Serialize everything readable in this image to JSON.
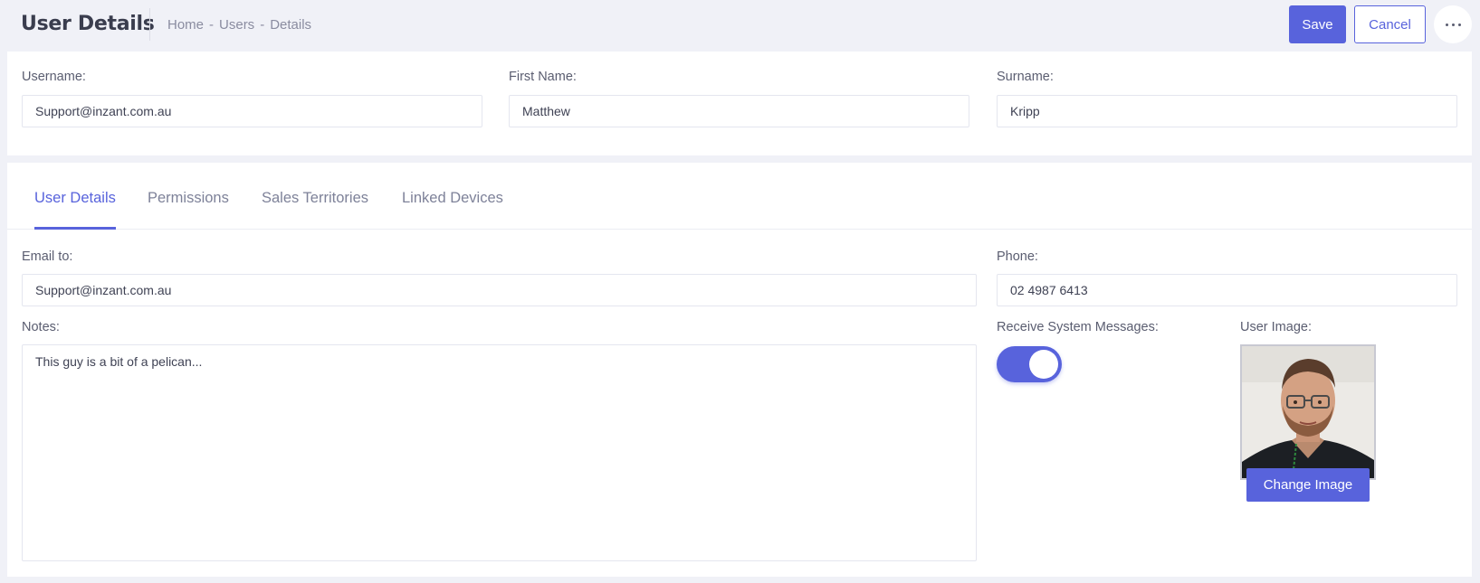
{
  "header": {
    "title": "User Details",
    "breadcrumb": [
      "Home",
      "Users",
      "Details"
    ],
    "breadcrumb_sep": "-",
    "save_label": "Save",
    "cancel_label": "Cancel",
    "more_icon": "more-horizontal-icon"
  },
  "top_form": {
    "username_label": "Username:",
    "username_value": "Support@inzant.com.au",
    "firstname_label": "First Name:",
    "firstname_value": "Matthew",
    "surname_label": "Surname:",
    "surname_value": "Kripp"
  },
  "tabs": [
    {
      "label": "User Details",
      "active": true
    },
    {
      "label": "Permissions",
      "active": false
    },
    {
      "label": "Sales Territories",
      "active": false
    },
    {
      "label": "Linked Devices",
      "active": false
    }
  ],
  "details": {
    "email_label": "Email to:",
    "email_value": "Support@inzant.com.au",
    "phone_label": "Phone:",
    "phone_value": "02 4987 6413",
    "notes_label": "Notes:",
    "notes_value": "This guy is a bit of a pelican...",
    "receive_label": "Receive System Messages:",
    "receive_on": true,
    "image_label": "User Image:",
    "change_image_label": "Change Image"
  },
  "colors": {
    "accent": "#5863dc",
    "background": "#f0f1f7"
  }
}
